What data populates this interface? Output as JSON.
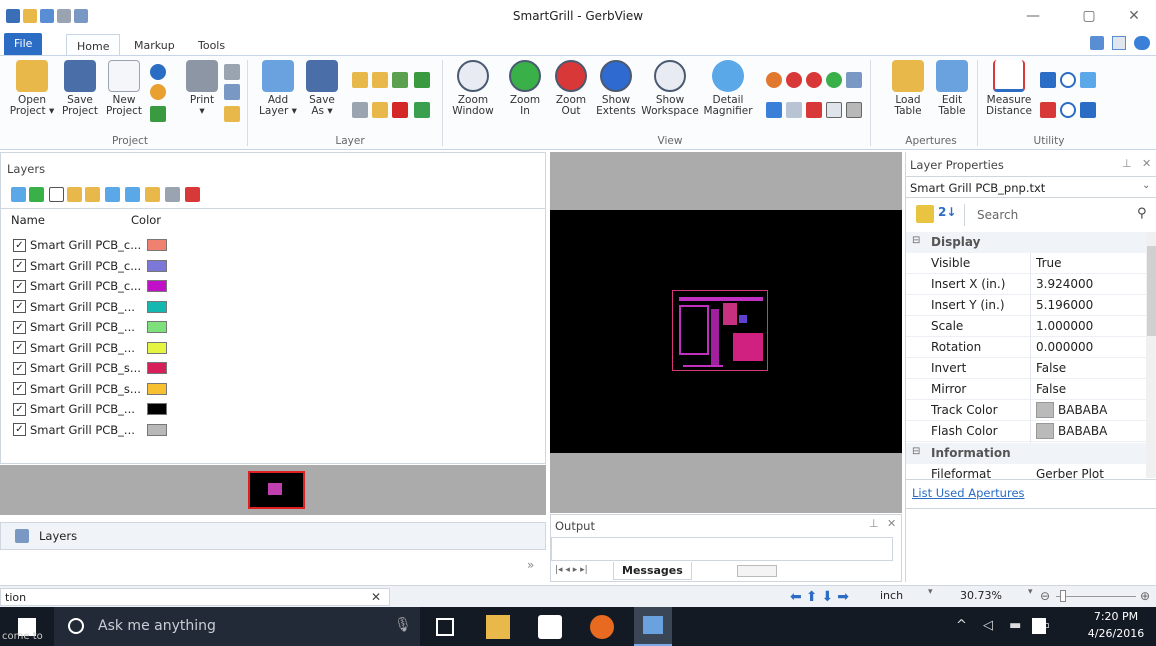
{
  "window": {
    "title": "SmartGrill - GerbView"
  },
  "ribbon_tabs": [
    "File",
    "Home",
    "Markup",
    "Tools"
  ],
  "ribbon": {
    "project": {
      "group": "Project",
      "buttons": [
        "Open\nProject ▾",
        "Save\nProject",
        "New\nProject"
      ]
    },
    "print": {
      "label": "Print\n▾"
    },
    "layer": {
      "group": "Layer",
      "buttons": [
        "Add\nLayer ▾",
        "Save\nAs ▾"
      ]
    },
    "view": {
      "group": "View",
      "buttons": [
        "Zoom\nWindow",
        "Zoom\nIn",
        "Zoom\nOut",
        "Show\nExtents",
        "Show\nWorkspace",
        "Detail\nMagnifier"
      ]
    },
    "apertures": {
      "group": "Apertures",
      "buttons": [
        "Load\nTable",
        "Edit\nTable"
      ]
    },
    "utility": {
      "group": "Utility",
      "buttons": [
        "Measure\nDistance"
      ]
    }
  },
  "layers_panel": {
    "title": "Layers",
    "col_name": "Name",
    "col_color": "Color",
    "rows": [
      {
        "name": "Smart Grill PCB_c...",
        "color": "#f08070"
      },
      {
        "name": "Smart Grill PCB_c...",
        "color": "#7b78d8"
      },
      {
        "name": "Smart Grill PCB_c...",
        "color": "#c010c8"
      },
      {
        "name": "Smart Grill PCB_...",
        "color": "#14b8b0"
      },
      {
        "name": "Smart Grill PCB_...",
        "color": "#7ee07a"
      },
      {
        "name": "Smart Grill PCB_...",
        "color": "#e4f440"
      },
      {
        "name": "Smart Grill PCB_s...",
        "color": "#d6205a"
      },
      {
        "name": "Smart Grill PCB_s...",
        "color": "#f6c030"
      },
      {
        "name": "Smart Grill PCB_...",
        "color": "#000000"
      },
      {
        "name": "Smart Grill PCB_...",
        "color": "#b8b8b8"
      }
    ],
    "bottom_tab": "Layers",
    "chevron": "»"
  },
  "output": {
    "title": "Output",
    "tab": "Messages",
    "nav": "|◂  ◂  ▸  ▸|"
  },
  "properties": {
    "title": "Layer Properties",
    "file": "Smart Grill PCB_pnp.txt",
    "search_placeholder": "Search",
    "section_display": "Display",
    "rows": [
      {
        "key": "Visible",
        "value": "True"
      },
      {
        "key": "Insert X (in.)",
        "value": "3.924000"
      },
      {
        "key": "Insert Y (in.)",
        "value": "5.196000"
      },
      {
        "key": "Scale",
        "value": "1.000000"
      },
      {
        "key": "Rotation",
        "value": "0.000000"
      },
      {
        "key": "Invert",
        "value": "False"
      },
      {
        "key": "Mirror",
        "value": "False"
      },
      {
        "key": "Track Color",
        "value": "BABABA",
        "swatch": "#bababa"
      },
      {
        "key": "Flash Color",
        "value": "BABABA",
        "swatch": "#bababa"
      }
    ],
    "section_info": "Information",
    "partial_key": "Fileformat",
    "partial_value": "Gerber Plot",
    "link": "List Used Apertures"
  },
  "status": {
    "left_text": "tion",
    "unit": "inch",
    "zoom": "30.73%"
  },
  "taskbar": {
    "search_placeholder": "Ask me anything",
    "time": "7:20 PM",
    "date": "4/26/2016",
    "start_overlay": "come to"
  }
}
